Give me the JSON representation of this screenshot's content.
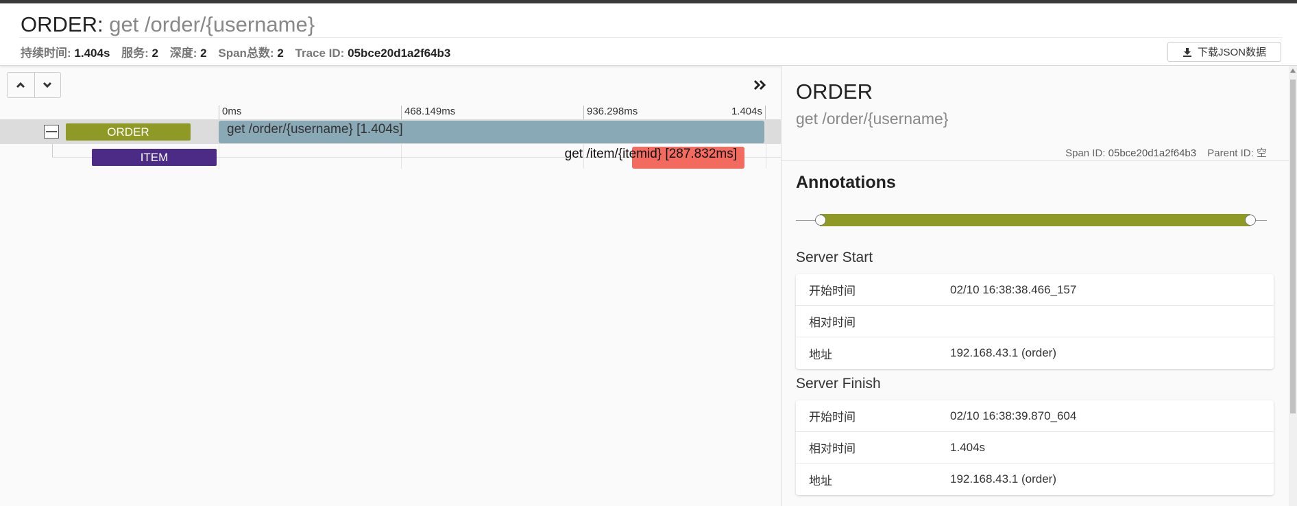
{
  "header": {
    "service": "ORDER",
    "separator": ":",
    "operation": "get /order/{username}",
    "meta": [
      {
        "label": "持续时间:",
        "value": "1.404s"
      },
      {
        "label": "服务:",
        "value": "2"
      },
      {
        "label": "深度:",
        "value": "2"
      },
      {
        "label": "Span总数:",
        "value": "2"
      },
      {
        "label": "Trace ID:",
        "value": "05bce20d1a2f64b3"
      }
    ],
    "download_label": "下载JSON数据"
  },
  "timeline": {
    "ticks": [
      "0ms",
      "468.149ms",
      "936.298ms",
      "1.404s"
    ],
    "spans": [
      {
        "service": "ORDER",
        "name": "get /order/{username} [1.404s]",
        "color": "#8aa9b6",
        "service_color": "#8f9a26"
      },
      {
        "service": "ITEM",
        "name": "get /item/{itemid} [287.832ms]",
        "color": "#f26b5e",
        "service_color": "#4c2b87"
      }
    ]
  },
  "detail": {
    "service": "ORDER",
    "operation": "get /order/{username}",
    "span_id_label": "Span ID:",
    "span_id": "05bce20d1a2f64b3",
    "parent_id_label": "Parent ID:",
    "parent_id": "空",
    "annotations_title": "Annotations",
    "slider_color": "#8f9a26",
    "sections": [
      {
        "title": "Server Start",
        "rows": [
          {
            "key": "开始时间",
            "value": "02/10 16:38:38.466_157"
          },
          {
            "key": "相对时间",
            "value": ""
          },
          {
            "key": "地址",
            "value": "192.168.43.1 (order)"
          }
        ]
      },
      {
        "title": "Server Finish",
        "rows": [
          {
            "key": "开始时间",
            "value": "02/10 16:38:39.870_604"
          },
          {
            "key": "相对时间",
            "value": "1.404s"
          },
          {
            "key": "地址",
            "value": "192.168.43.1 (order)"
          }
        ]
      }
    ]
  }
}
